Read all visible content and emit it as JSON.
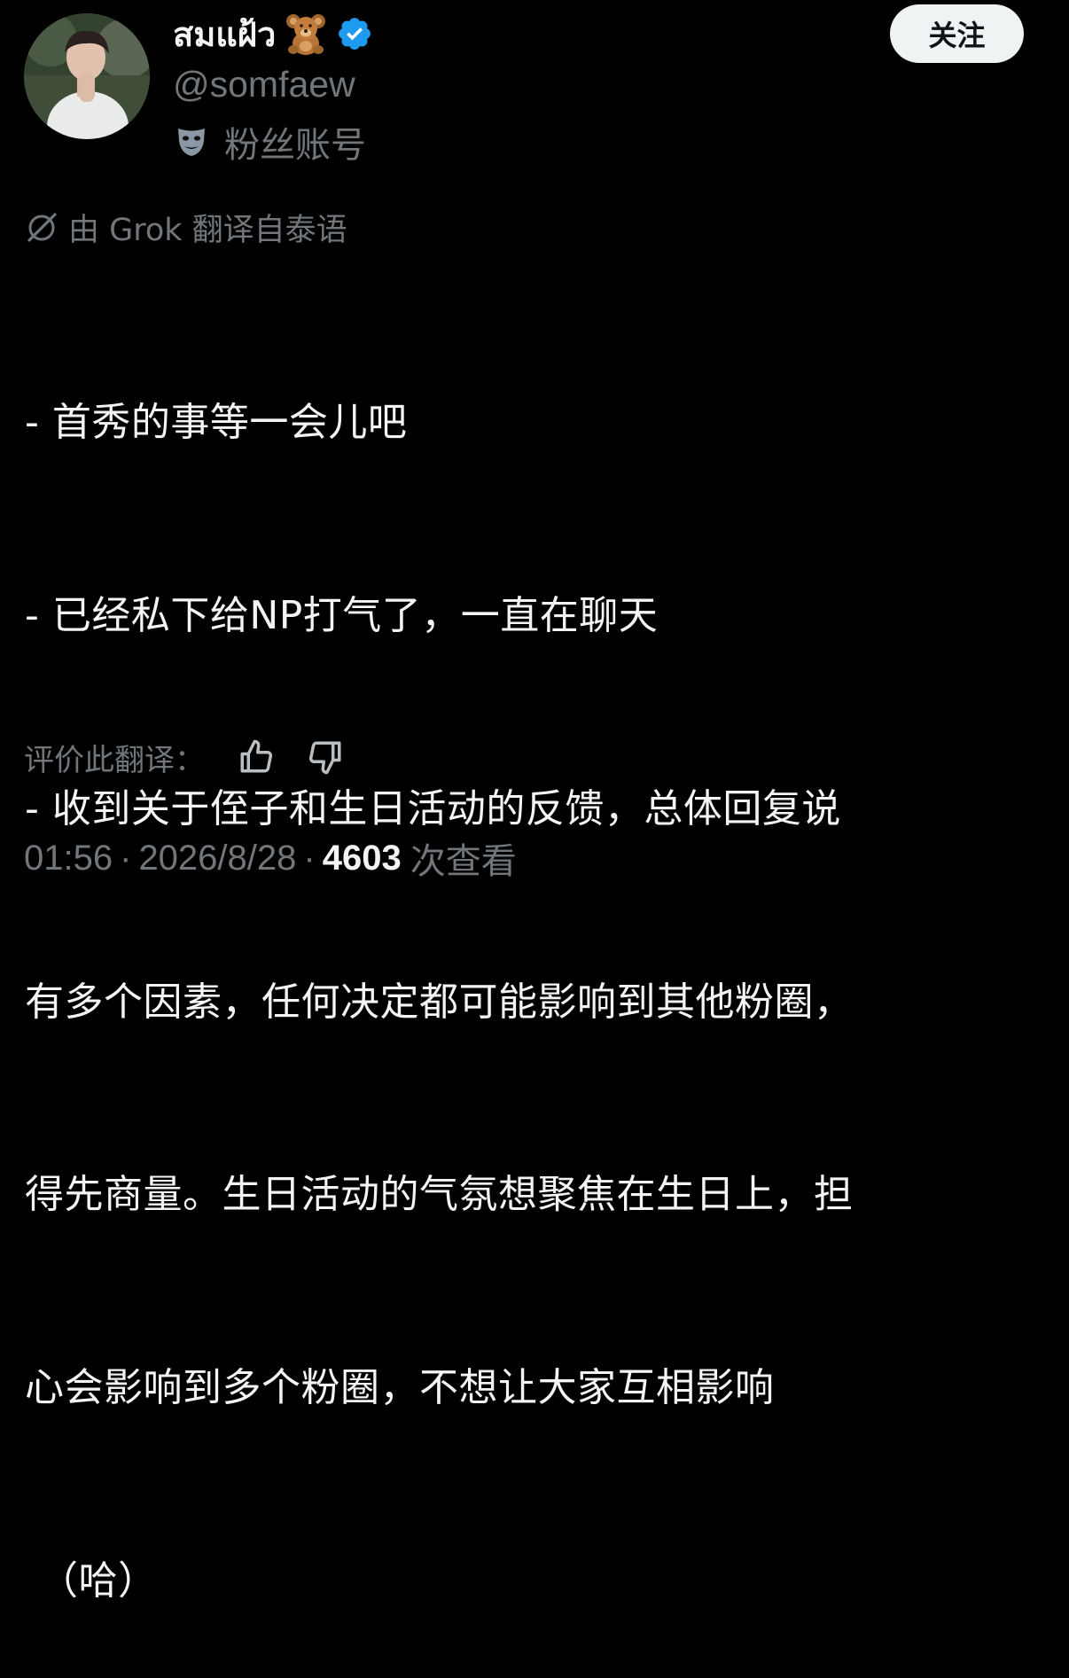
{
  "user": {
    "display_name": "สมแฝ้ว",
    "emoji": "🧸",
    "handle": "@somfaew",
    "account_label": "粉丝账号",
    "account_icon": "theater-mask-icon",
    "verified_color": "#1d9bf0"
  },
  "follow_button": {
    "label": "关注"
  },
  "translation": {
    "label": "由 Grok 翻译自泰语",
    "rate_label": "评价此翻译："
  },
  "tweet": {
    "lines": [
      "- 首秀的事等一会儿吧",
      "- 已经私下给NP打气了，一直在聊天",
      "- 收到关于侄子和生日活动的反馈，总体回复说",
      "有多个因素，任何决定都可能影响到其他粉圈，",
      "得先商量。生日活动的气氛想聚焦在生日上，担",
      "心会影响到多个粉圈，不想让大家互相影响",
      "（哈）"
    ]
  },
  "meta": {
    "time": "01:56",
    "separator": "·",
    "date": "2026/8/28",
    "views_count": "4603",
    "views_label": "次查看"
  }
}
